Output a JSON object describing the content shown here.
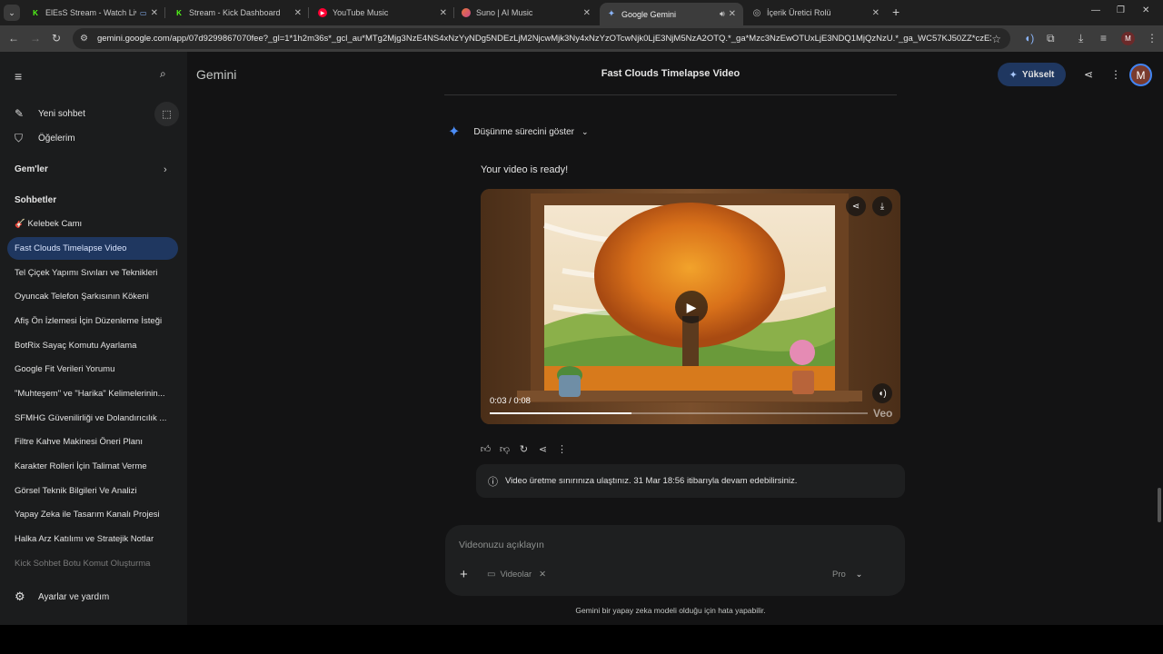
{
  "browser": {
    "tabs": [
      {
        "label": "ElEsS Stream - Watch Live",
        "favicon": "kick-icon",
        "color": "#53fc18"
      },
      {
        "label": "Stream - Kick Dashboard",
        "favicon": "kick-icon",
        "color": "#53fc18"
      },
      {
        "label": "YouTube Music",
        "favicon": "youtube-music-icon",
        "color": "#ff0033"
      },
      {
        "label": "Suno | AI Music",
        "favicon": "suno-icon",
        "color": "#e8743b"
      },
      {
        "label": "Google Gemini",
        "favicon": "gemini-icon",
        "color": "#8ab4f8"
      },
      {
        "label": "İçerik Üretici Rolü",
        "favicon": "globe-icon",
        "color": "#bbbbbb"
      }
    ],
    "active_tab": 4,
    "url": "gemini.google.com/app/07d9299867070fee?_gl=1*1h2m36s*_gcl_au*MTg2Mjg3NzE4NS4xNzYyNDg5NDEzLjM2NjcwMjk3Ny4xNzYzOTcwNjk0LjE3NjM5NzA2OTQ.*_ga*Mzc3NzEwOTUxLjE3NDQ1MjQzNzU.*_ga_WC57KJ50ZZ*czE3NjM5NzA..."
  },
  "sidebar": {
    "new_chat": "Yeni sohbet",
    "items": "Öğelerim",
    "gems_heading": "Gem'ler",
    "chats_heading": "Sohbetler",
    "chats": [
      "🎸 Kelebek Camı",
      "Fast Clouds Timelapse Video",
      "Tel Çiçek Yapımı Sıvıları ve Teknikleri",
      "Oyuncak Telefon Şarkısının Kökeni",
      "Afiş Ön İzlemesi İçin Düzenleme İsteği",
      "BotRix Sayaç Komutu Ayarlama",
      "Google Fit Verileri Yorumu",
      "\"Muhteşem\" ve \"Harika\" Kelimelerinin...",
      "SFMHG Güvenilirliği ve Dolandırıcılık ...",
      "Filtre Kahve Makinesi Öneri Planı",
      "Karakter Rolleri İçin Talimat Verme",
      "Görsel Teknik Bilgileri Ve Analizi",
      "Yapay Zeka ile Tasarım Kanalı Projesi",
      "Halka Arz Katılımı ve Stratejik Notlar",
      "Kick Sohbet Botu Komut Oluşturma"
    ],
    "active_chat": 1,
    "settings": "Ayarlar ve yardım"
  },
  "header": {
    "brand": "Gemini",
    "title": "Fast Clouds Timelapse Video",
    "upgrade": "Yükselt",
    "avatar_letter": "M"
  },
  "conversation": {
    "thinking_toggle": "Düşünme sürecini göster",
    "response_text": "Your video is ready!",
    "video": {
      "time": "0:03 / 0:08",
      "progress": 0.375,
      "watermark": "Veo"
    },
    "notice": "Video üretme sınırınıza ulaştınız. 31 Mar 18:56 itibarıyla devam edebilirsiniz."
  },
  "composer": {
    "placeholder": "Videonuzu açıklayın",
    "tool_chip": "Videolar",
    "model": "Pro"
  },
  "footer": {
    "disclaimer": "Gemini bir yapay zeka modeli olduğu için hata yapabilir."
  },
  "colors": {
    "accent": "#1f3760",
    "gemini_blue": "#4c8df6",
    "main_bg": "#131314",
    "sidebar_bg": "#1b1c1d"
  }
}
